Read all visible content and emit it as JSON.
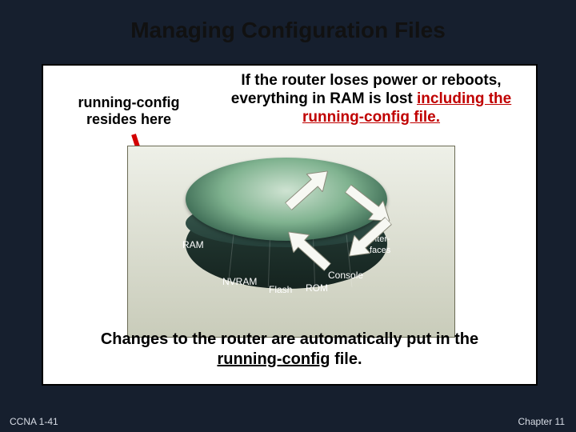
{
  "title": "Managing Configuration Files",
  "left_caption_line1": "running-config",
  "left_caption_line2": "resides here",
  "right_text_plain1": "If the router loses power or reboots, everything in RAM is lost ",
  "right_text_emph": "including the running-config file.",
  "bottom_text_prefix": "Changes to the router are automatically put in the ",
  "bottom_text_underlined": "running-config",
  "bottom_text_suffix": " file.",
  "router": {
    "labels": {
      "ram": "RAM",
      "nvram": "NVRAM",
      "flash": "Flash",
      "rom": "ROM",
      "console": "Console",
      "interfaces_l1": "Inter-",
      "interfaces_l2": "faces"
    }
  },
  "footer": {
    "left": "CCNA 1-41",
    "right": "Chapter 11"
  }
}
